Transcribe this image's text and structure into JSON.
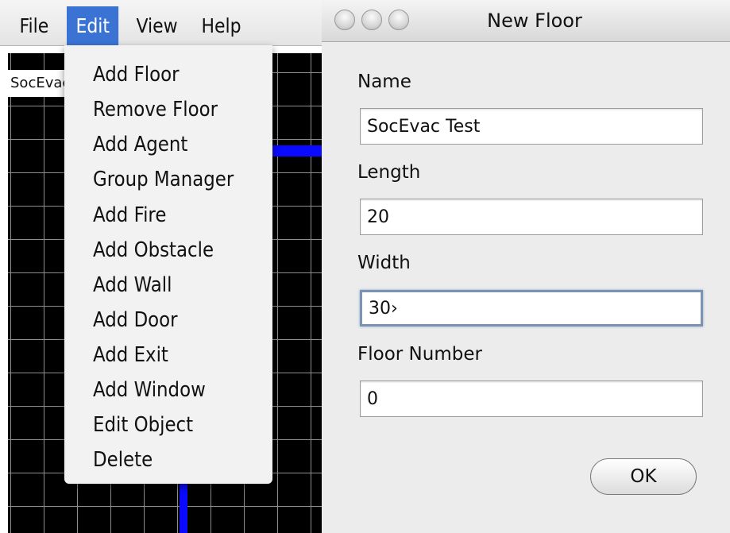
{
  "menubar": {
    "items": [
      {
        "label": "File"
      },
      {
        "label": "Edit"
      },
      {
        "label": "View"
      },
      {
        "label": "Help"
      }
    ],
    "active": "Edit"
  },
  "canvas": {
    "floor_label": "SocEvacT"
  },
  "edit_menu": {
    "items": [
      {
        "label": "Add Floor"
      },
      {
        "label": "Remove Floor"
      },
      {
        "label": "Add Agent"
      },
      {
        "label": "Group Manager"
      },
      {
        "label": "Add Fire"
      },
      {
        "label": "Add Obstacle"
      },
      {
        "label": "Add Wall"
      },
      {
        "label": "Add Door"
      },
      {
        "label": "Add Exit"
      },
      {
        "label": "Add Window"
      },
      {
        "label": "Edit Object"
      },
      {
        "label": "Delete"
      }
    ]
  },
  "dialog": {
    "title": "New Floor",
    "fields": {
      "name": {
        "label": "Name",
        "value": "SocEvac Test"
      },
      "length": {
        "label": "Length",
        "value": "20"
      },
      "width": {
        "label": "Width",
        "value": "30›"
      },
      "floor_number": {
        "label": "Floor Number",
        "value": "0"
      }
    },
    "ok_label": "OK"
  },
  "colors": {
    "menu_highlight": "#3b73d4",
    "wall": "#0a0aff",
    "canvas_bg": "#000000",
    "grid": "#8e8e8e"
  }
}
